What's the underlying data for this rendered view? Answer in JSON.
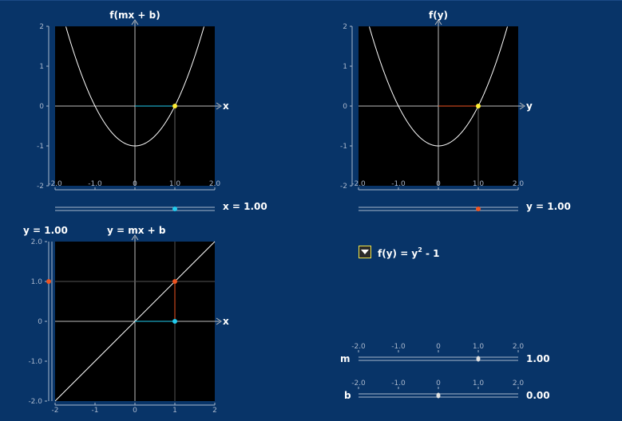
{
  "panels": {
    "top_left": {
      "title": "f(mx + b)",
      "x_axis_label": "x",
      "x_ticks": [
        "-2.0",
        "-1.0",
        "0",
        "1.0",
        "2.0"
      ],
      "y_ticks": [
        "2",
        "1",
        "0",
        "-1",
        "-2"
      ],
      "slider_readout": "x = 1.00",
      "slider_value": 1.0
    },
    "top_right": {
      "title": "f(y)",
      "x_axis_label": "y",
      "x_ticks": [
        "-2.0",
        "-1.0",
        "0",
        "1.0",
        "2.0"
      ],
      "y_ticks": [
        "2",
        "1",
        "0",
        "-1",
        "-2"
      ],
      "slider_readout": "y = 1.00",
      "slider_value": 1.0
    },
    "bottom_left": {
      "y_readout": "y = 1.00",
      "title": "y = mx + b",
      "x_axis_label": "x",
      "x_ticks": [
        "-2",
        "-1",
        "0",
        "1",
        "2"
      ],
      "y_ticks": [
        "2.0",
        "1.0",
        "0",
        "-1.0",
        "-2.0"
      ]
    }
  },
  "function_select": {
    "prefix": "f(y) = y",
    "exponent": "2",
    "suffix": " - 1"
  },
  "sliders": {
    "ticks": [
      "-2.0",
      "-1.0",
      "0",
      "1.0",
      "2.0"
    ],
    "m": {
      "label": "m",
      "readout": "1.00",
      "value": 1.0
    },
    "b": {
      "label": "b",
      "readout": "0.00",
      "value": 0.0
    }
  },
  "colors": {
    "background": "#083468",
    "plot_bg": "#000000",
    "curve": "#ffffff",
    "x_marker": "#22ccee",
    "y_marker": "#ee5522",
    "point": "#ffee33"
  }
}
